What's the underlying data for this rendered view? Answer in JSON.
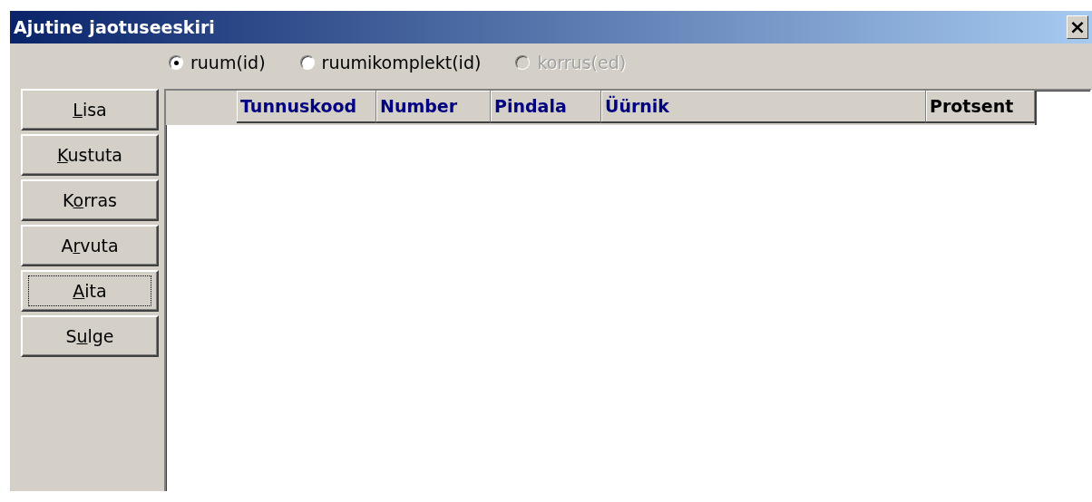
{
  "window": {
    "title": "Ajutine jaotuseeskiri",
    "close": "×"
  },
  "scope_options": [
    {
      "label": "ruum(id)",
      "selected": true,
      "disabled": false
    },
    {
      "label": "ruumikomplekt(id)",
      "selected": false,
      "disabled": false
    },
    {
      "label": "korrus(ed)",
      "selected": false,
      "disabled": true
    }
  ],
  "buttons": [
    {
      "parts": [
        {
          "text": "L",
          "underline": true
        },
        {
          "text": "isa",
          "underline": false
        }
      ],
      "focused": false
    },
    {
      "parts": [
        {
          "text": "K",
          "underline": true
        },
        {
          "text": "ustuta",
          "underline": false
        }
      ],
      "focused": false
    },
    {
      "parts": [
        {
          "text": "K",
          "underline": false
        },
        {
          "text": "o",
          "underline": true
        },
        {
          "text": "rras",
          "underline": false
        }
      ],
      "focused": false
    },
    {
      "parts": [
        {
          "text": "A",
          "underline": false
        },
        {
          "text": "r",
          "underline": true
        },
        {
          "text": "vuta",
          "underline": false
        }
      ],
      "focused": false
    },
    {
      "parts": [
        {
          "text": "A",
          "underline": true
        },
        {
          "text": "ita",
          "underline": false
        }
      ],
      "focused": true
    },
    {
      "parts": [
        {
          "text": "S",
          "underline": false
        },
        {
          "text": "u",
          "underline": true
        },
        {
          "text": "lge",
          "underline": false
        }
      ],
      "focused": false
    }
  ],
  "table": {
    "columns": [
      {
        "label": "Tunnuskood",
        "color": "#000080"
      },
      {
        "label": "Number",
        "color": "#000080"
      },
      {
        "label": "Pindala",
        "color": "#000080"
      },
      {
        "label": "Üürnik",
        "color": "#000080"
      },
      {
        "label": "Protsent",
        "color": "#000000"
      }
    ]
  }
}
